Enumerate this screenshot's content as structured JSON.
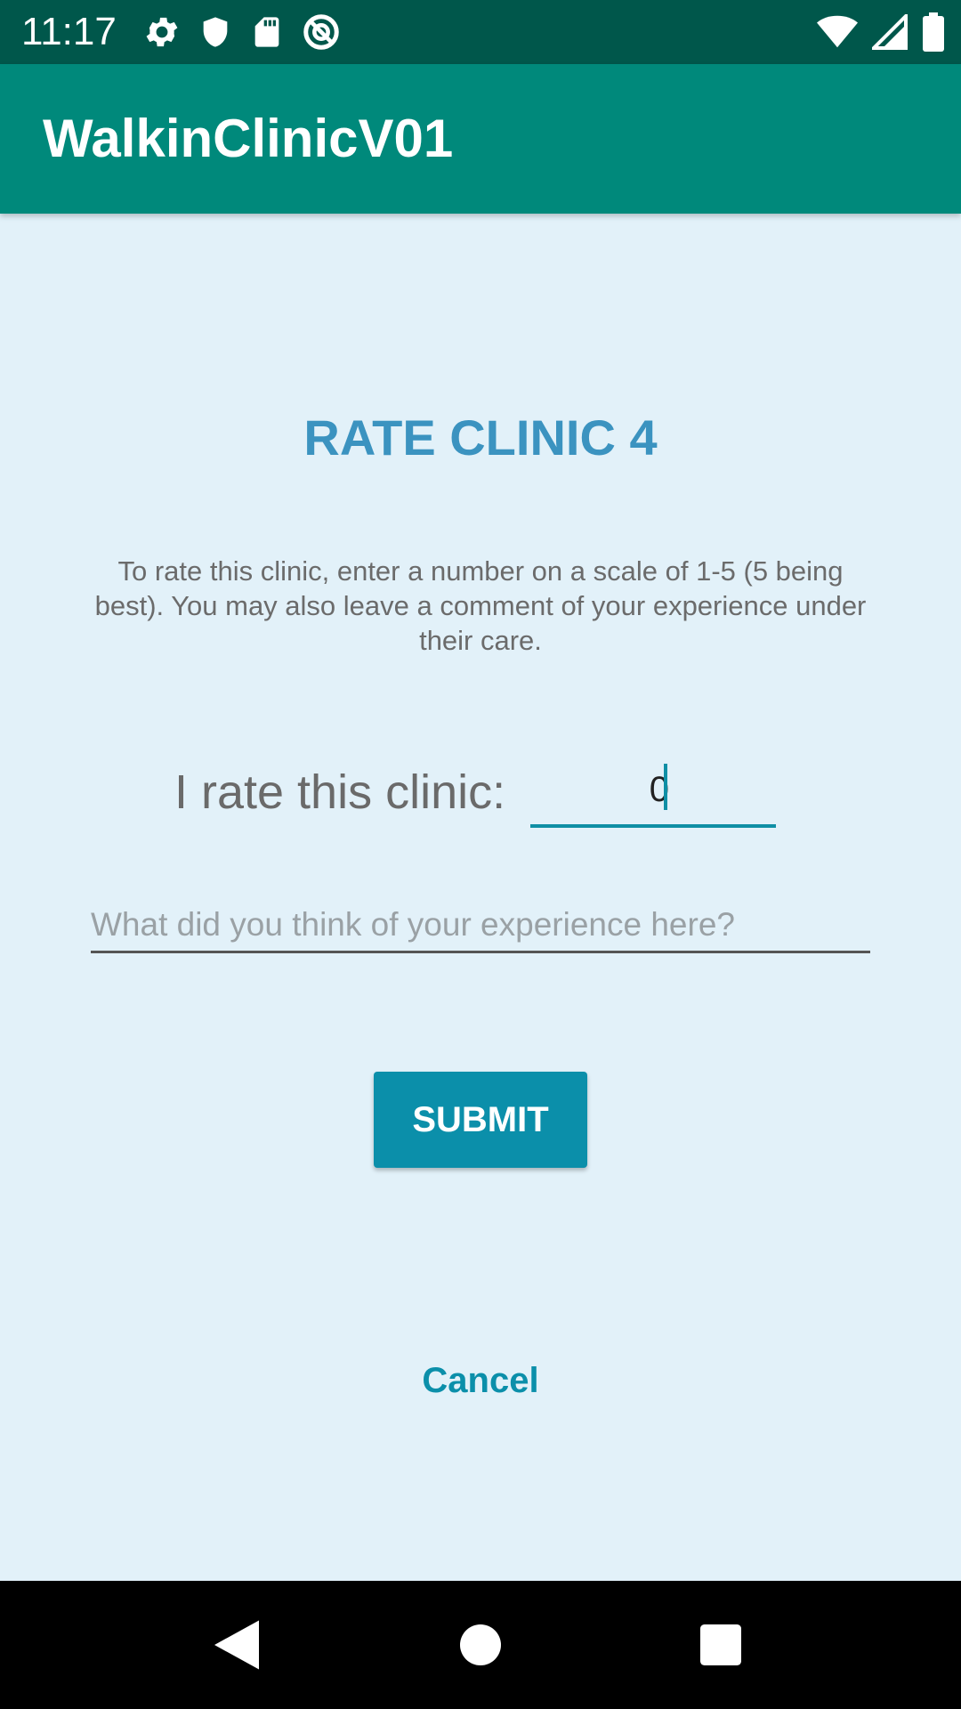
{
  "status_bar": {
    "time": "11:17",
    "left_icons": [
      "gear-icon",
      "shield-icon",
      "sd-card-icon",
      "data-saver-icon"
    ],
    "right_icons": [
      "wifi-icon",
      "cell-signal-icon",
      "battery-icon"
    ]
  },
  "app_bar": {
    "title": "WalkinClinicV01",
    "color": "#00897b"
  },
  "main": {
    "title": "RATE CLINIC 4",
    "instructions": "To rate this clinic, enter a number on a scale of 1-5 (5 being best). You may also leave a comment of your experience under their care.",
    "rate_label": "I rate this clinic:",
    "rate_value": "0",
    "comment_placeholder": "What did you think of your experience here?",
    "submit_label": "SUBMIT",
    "cancel_label": "Cancel"
  },
  "nav_bar": {
    "buttons": [
      "back-icon",
      "home-icon",
      "recents-icon"
    ]
  }
}
